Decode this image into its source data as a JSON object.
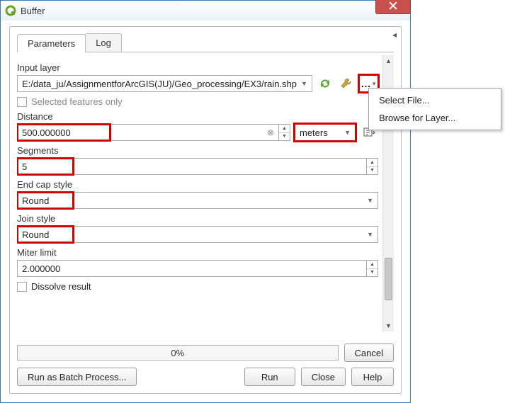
{
  "window": {
    "title": "Buffer"
  },
  "tabs": {
    "parameters": "Parameters",
    "log": "Log"
  },
  "labels": {
    "input_layer": "Input layer",
    "selected_only": "Selected features only",
    "distance": "Distance",
    "segments": "Segments",
    "end_cap": "End cap style",
    "join_style": "Join style",
    "miter_limit": "Miter limit",
    "dissolve": "Dissolve result"
  },
  "values": {
    "input_layer": "E:/data_ju/AssignmentforArcGIS(JU)/Geo_processing/EX3/rain.shp",
    "distance": "500.000000",
    "distance_unit": "meters",
    "segments": "5",
    "end_cap": "Round",
    "join_style": "Round",
    "miter_limit": "2.000000"
  },
  "progress": {
    "text": "0%"
  },
  "buttons": {
    "cancel": "Cancel",
    "batch": "Run as Batch Process...",
    "run": "Run",
    "close": "Close",
    "help": "Help"
  },
  "menu": {
    "select_file": "Select File...",
    "browse_layer": "Browse for Layer..."
  },
  "icons": {
    "qgis": "qgis-icon",
    "close_window": "close-icon",
    "reload": "reload-icon",
    "wrench": "wrench-icon",
    "browse": "browse-icon",
    "expr": "expression-icon"
  }
}
